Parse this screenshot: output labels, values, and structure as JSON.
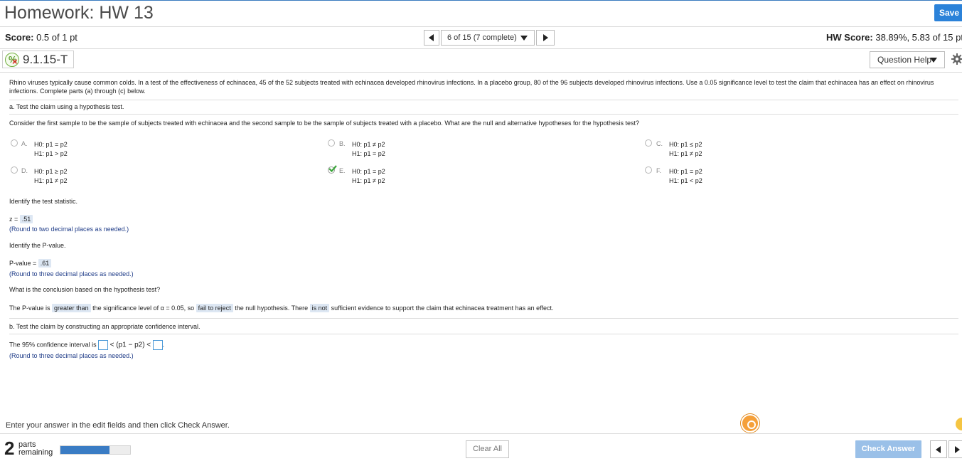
{
  "header": {
    "title": "Homework: HW 13",
    "save_label": "Save"
  },
  "status_bar": {
    "score_label": "Score:",
    "score_value": "0.5 of 1 pt",
    "nav_select": "6 of 15 (7 complete)",
    "hw_score_label": "HW Score:",
    "hw_score_value": "38.89%, 5.83 of 15 pt"
  },
  "question": {
    "id": "9.1.15-T",
    "help_label": "Question Help",
    "intro": "Rhino viruses typically cause common colds. In a test of the effectiveness of echinacea, 45 of the 52 subjects treated with echinacea developed rhinovirus infections. In a placebo group, 80 of the 96 subjects developed rhinovirus infections. Use a 0.05 significance level to test the claim that echinacea has an effect on rhinovirus infections. Complete parts (a) through (c) below.",
    "part_a_heading": "a. Test the claim using a hypothesis test.",
    "part_a_prompt": "Consider the first sample to be the sample of subjects treated with echinacea and the second sample to be the sample of subjects treated with a placebo. What are the null and alternative hypotheses for the hypothesis test?",
    "options": [
      {
        "letter": "A.",
        "h0": "H0: p1 = p2",
        "h1": "H1: p1 > p2"
      },
      {
        "letter": "B.",
        "h0": "H0: p1 ≠ p2",
        "h1": "H1: p1 = p2"
      },
      {
        "letter": "C.",
        "h0": "H0: p1 ≤ p2",
        "h1": "H1: p1 ≠ p2"
      },
      {
        "letter": "D.",
        "h0": "H0: p1 ≥ p2",
        "h1": "H1: p1 ≠ p2"
      },
      {
        "letter": "E.",
        "h0": "H0: p1 = p2",
        "h1": "H1: p1 ≠ p2"
      },
      {
        "letter": "F.",
        "h0": "H0: p1 = p2",
        "h1": "H1: p1 < p2"
      }
    ],
    "selected_option": "E.",
    "test_stat_prompt": "Identify the test statistic.",
    "z_label": "z =",
    "z_value": ".51",
    "round_two": "(Round to two decimal places as needed.)",
    "pvalue_prompt": "Identify the P-value.",
    "pvalue_label": "P-value =",
    "pvalue_value": ".61",
    "round_three": "(Round to three decimal places as needed.)",
    "conclusion_prompt": "What is the conclusion based on the hypothesis test?",
    "conclusion": {
      "part1": "The P-value is",
      "ans1": "greater than",
      "part2": "the significance level of α = 0.05, so",
      "ans2": "fail to reject",
      "part3": "the null hypothesis. There",
      "ans3": "is not",
      "part4": "sufficient evidence to support the claim that echinacea treatment has an effect."
    },
    "part_b_heading": "b. Test the claim by constructing an appropriate confidence interval.",
    "ci_label": "The 95% confidence interval is",
    "ci_middle": "< (p1 − p2) <",
    "ci_end": ".",
    "round_three_b": "(Round to three decimal places as needed.)"
  },
  "footer": {
    "instructions": "Enter your answer in the edit fields and then click Check Answer.",
    "parts_count": "2",
    "parts_word": "parts",
    "remaining_word": "remaining",
    "progress_fraction": 0.7,
    "clear_all": "Clear All",
    "check_answer": "Check Answer"
  }
}
